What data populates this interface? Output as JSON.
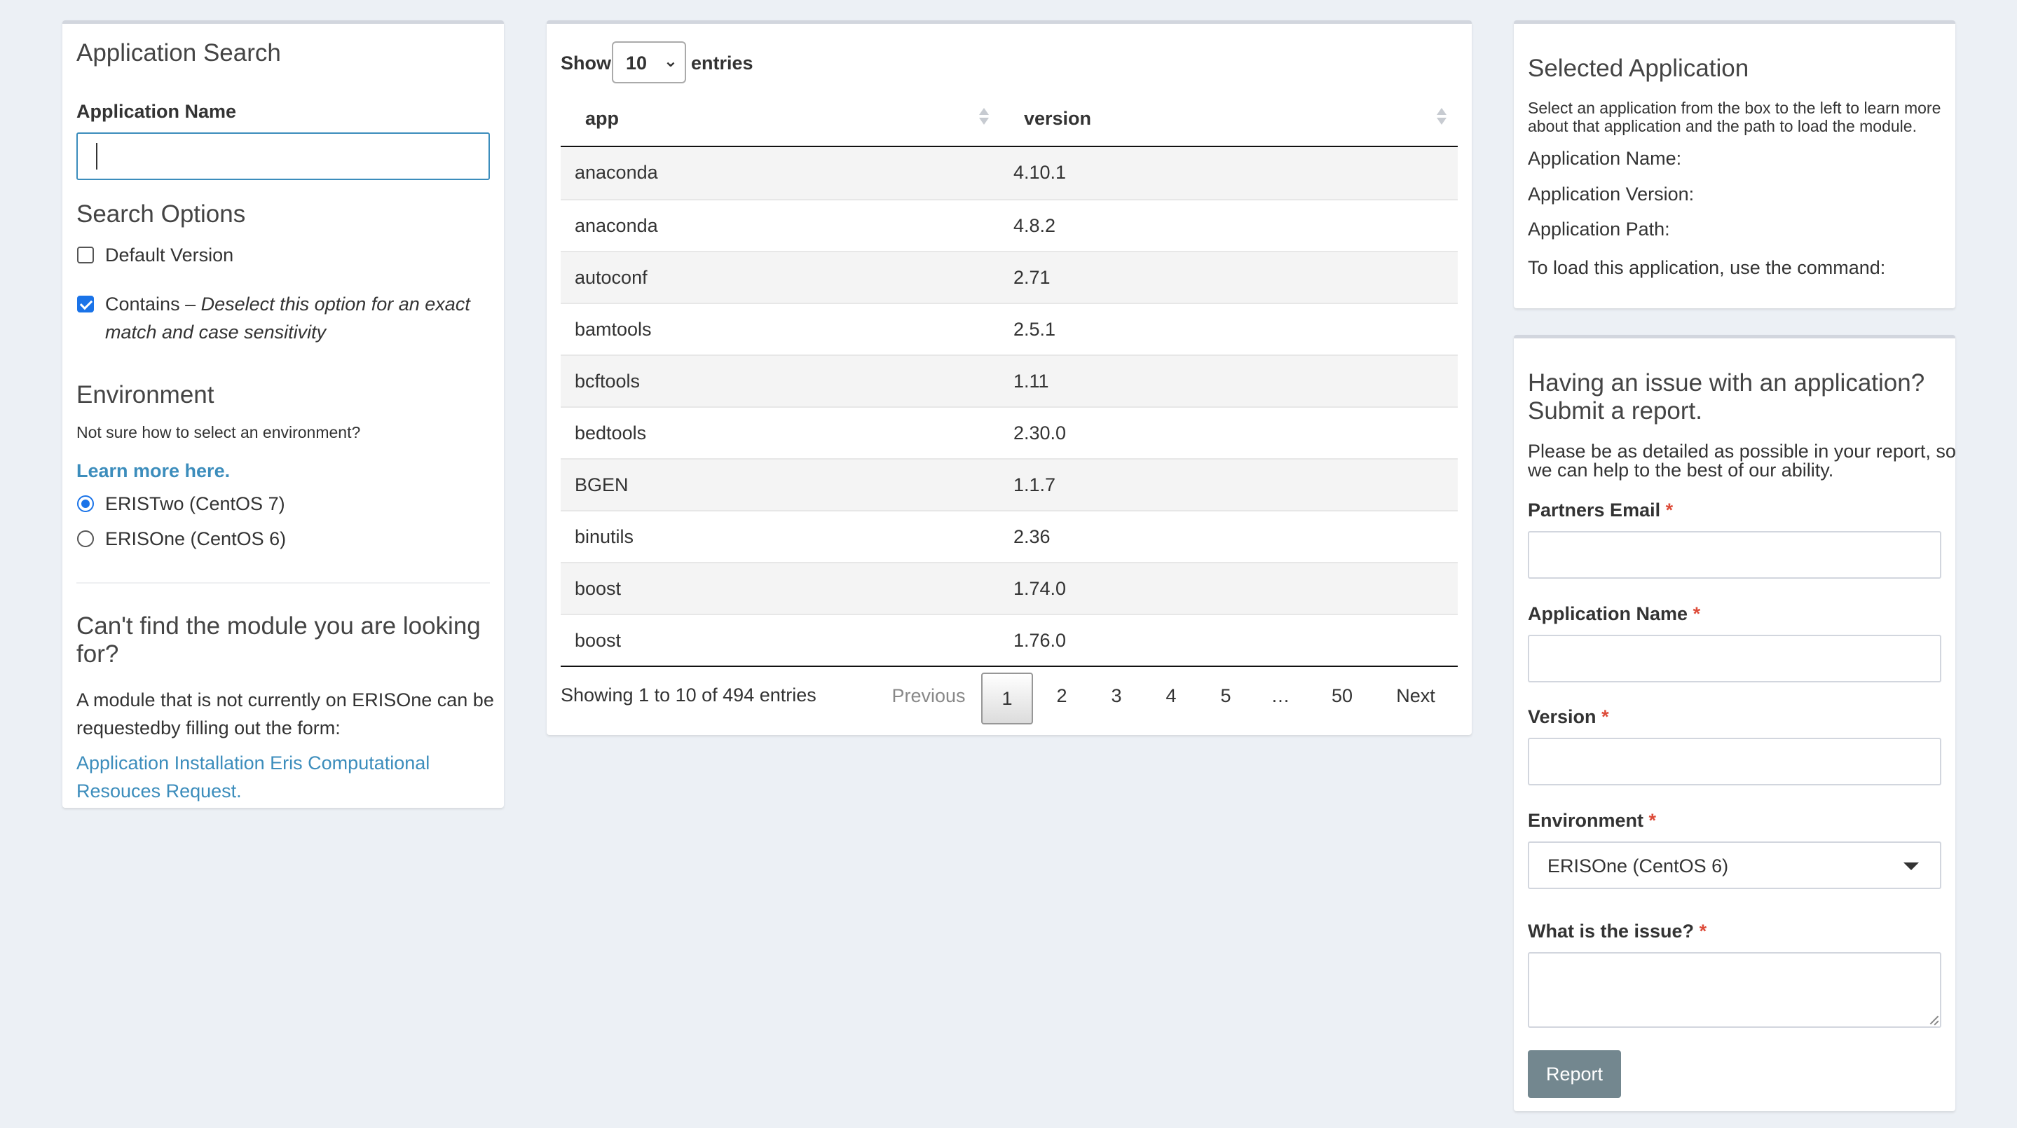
{
  "search": {
    "title": "Application Search",
    "app_name_label": "Application Name",
    "app_name_value": "",
    "options_title": "Search Options",
    "default_version_label": "Default Version",
    "default_version_checked": false,
    "contains_label": "Contains",
    "contains_note_line1": "Deselect this option for an exact",
    "contains_note_line2": "match and case sensitivity",
    "contains_checked": true,
    "env_title": "Environment",
    "env_help": "Not sure how to select an environment?",
    "env_learn_more": "Learn more here.",
    "env_options": [
      {
        "label": "ERISTwo (CentOS 7)",
        "selected": true
      },
      {
        "label": "ERISOne (CentOS 6)",
        "selected": false
      }
    ],
    "cant_find_line1": "Can't find the module you are looking",
    "cant_find_line2": "for?",
    "request_text_line1": "A module that is not currently on ERISOne can be",
    "request_text_line2": "requestedby filling out the form:",
    "request_link_line1": "Application Installation Eris Computational",
    "request_link_line2": "Resouces Request."
  },
  "table": {
    "show_label": "Show",
    "entries_label": "entries",
    "page_size": "10",
    "columns": [
      "app",
      "version"
    ],
    "rows": [
      [
        "anaconda",
        "4.10.1"
      ],
      [
        "anaconda",
        "4.8.2"
      ],
      [
        "autoconf",
        "2.71"
      ],
      [
        "bamtools",
        "2.5.1"
      ],
      [
        "bcftools",
        "1.11"
      ],
      [
        "bedtools",
        "2.30.0"
      ],
      [
        "BGEN",
        "1.1.7"
      ],
      [
        "binutils",
        "2.36"
      ],
      [
        "boost",
        "1.74.0"
      ],
      [
        "boost",
        "1.76.0"
      ]
    ],
    "info": "Showing 1 to 10 of 494 entries",
    "pagination": {
      "previous": "Previous",
      "pages": [
        "1",
        "2",
        "3",
        "4",
        "5",
        "…",
        "50"
      ],
      "current": "1",
      "next": "Next"
    }
  },
  "selected": {
    "title": "Selected Application",
    "desc_line1": "Select an application from the box to the left to learn more",
    "desc_line2": "about that application and the path to load the module.",
    "name_label": "Application Name:",
    "version_label": "Application Version:",
    "path_label": "Application Path:",
    "command_label": "To load this application, use the command:"
  },
  "report": {
    "title_line1": "Having an issue with an application?",
    "title_line2": "Submit a report.",
    "desc_line1": "Please be as detailed as possible in your report, so",
    "desc_line2": "we can help to the best of our ability.",
    "required_mark": "*",
    "email_label": "Partners Email",
    "app_name_label": "Application Name",
    "version_label": "Version",
    "environment_label": "Environment",
    "environment_value": "ERISOne (CentOS 6)",
    "issue_label": "What is the issue?",
    "submit_label": "Report"
  },
  "colors": {
    "background": "#ecf0f5",
    "link": "#3c8dbc",
    "required": "#dd4b39",
    "button": "#73878f",
    "checkbox_accent": "#1a73e8"
  }
}
